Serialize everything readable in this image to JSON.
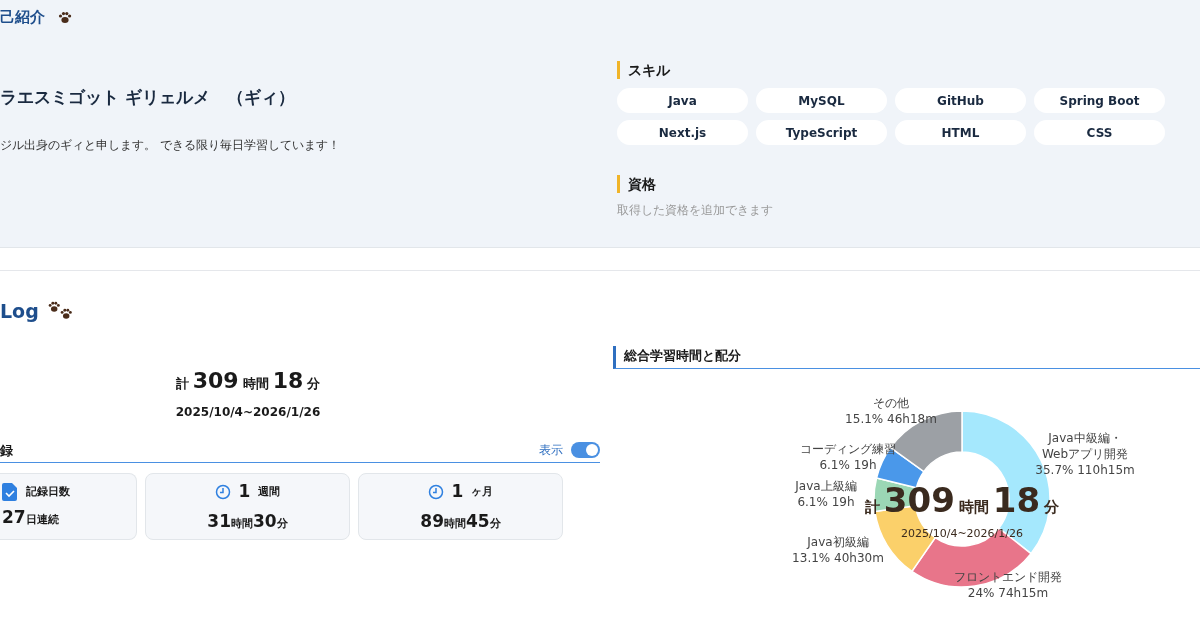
{
  "profile": {
    "heading": "己紹介",
    "name": "ラエスミゴット ギリェルメ　（ギィ）",
    "bio": "ジル出身のギィと申します。 できる限り毎日学習しています！",
    "skills_heading": "スキル",
    "skills": [
      "Java",
      "MySQL",
      "GitHub",
      "Spring Boot",
      "Next.js",
      "TypeScript",
      "HTML",
      "CSS"
    ],
    "certs_heading": "資格",
    "certs_placeholder": "取得した資格を追加できます"
  },
  "log": {
    "heading": "Log",
    "total": {
      "prefix": "計",
      "hours": "309",
      "hours_unit": "時間",
      "minutes": "18",
      "minutes_unit": "分"
    },
    "range": "2025/10/4~2026/1/26",
    "records": {
      "heading": "録",
      "toggle_label": "表示",
      "toggle_on": true,
      "cards": [
        {
          "kind": "days",
          "title": "記録日数",
          "value_parts": [
            [
              "27",
              "日連続"
            ]
          ]
        },
        {
          "kind": "period",
          "title_number": "1",
          "title": "週間",
          "value_parts": [
            [
              "31",
              "時間"
            ],
            [
              "30",
              "分"
            ]
          ]
        },
        {
          "kind": "period",
          "title_number": "1",
          "title": "ヶ月",
          "value_parts": [
            [
              "89",
              "時間"
            ],
            [
              "45",
              "分"
            ]
          ]
        }
      ]
    },
    "distribution": {
      "title": "総合学習時間と配分",
      "center": {
        "prefix": "計",
        "hours": "309",
        "hours_unit": "時間",
        "minutes": "18",
        "minutes_unit": "分",
        "range": "2025/10/4~2026/1/26"
      },
      "chart_data": {
        "type": "donut",
        "colors": [
          "#a5e8fd",
          "#e8758a",
          "#fbd06a",
          "#9bd7b5",
          "#4a98ea",
          "#9ca0a5"
        ],
        "categories": [
          "Java中級編・\nWebアプリ開発",
          "フロントエンド開発",
          "Java初級編",
          "Java上級編",
          "コーディング練習",
          "その他"
        ],
        "values": [
          35.7,
          24,
          13.1,
          6.1,
          6.1,
          15.1
        ],
        "value_labels": [
          "35.7% 110h15m",
          "24% 74h15m",
          "13.1% 40h30m",
          "6.1% 19h",
          "6.1% 19h",
          "15.1% 46h18m"
        ]
      }
    }
  }
}
